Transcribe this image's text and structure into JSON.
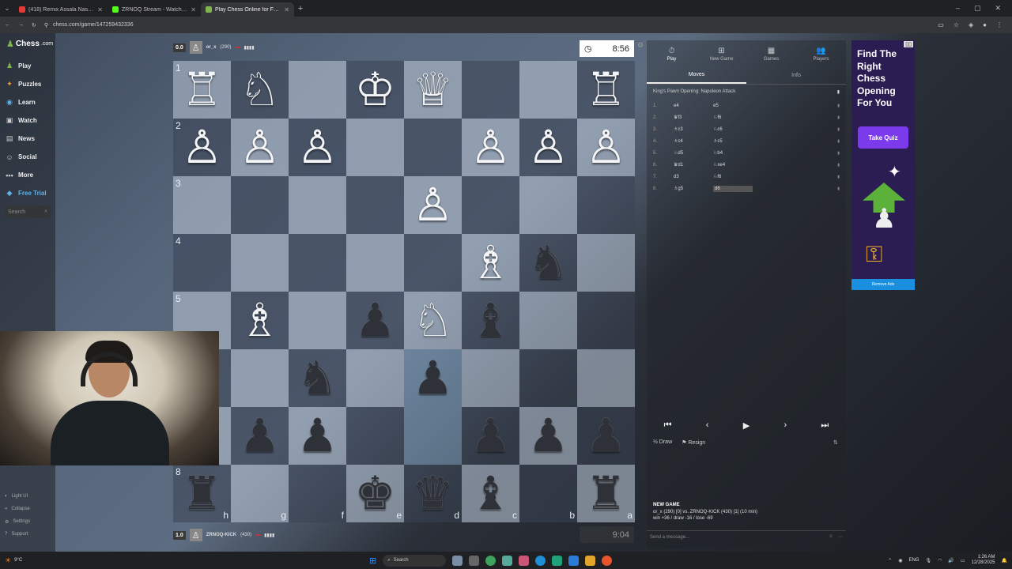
{
  "browser": {
    "tabs": [
      {
        "title": "(418) Remix Assala Nasri &",
        "color": "#e53935",
        "active": false
      },
      {
        "title": "ZRNOQ Stream - Watch Live o",
        "color": "#53fc18",
        "active": false
      },
      {
        "title": "Play Chess Online for FREE - 2",
        "color": "#81b64c",
        "active": true
      }
    ],
    "url": "chess.com/game/147259432336"
  },
  "sidebar": {
    "logo": "Chess",
    "logo_suffix": ".com",
    "items": [
      {
        "label": "Play",
        "icon": "♟",
        "color": "#81b64c"
      },
      {
        "label": "Puzzles",
        "icon": "✦",
        "color": "#f39c3d"
      },
      {
        "label": "Learn",
        "icon": "◉",
        "color": "#5fb2e8"
      },
      {
        "label": "Watch",
        "icon": "▣",
        "color": "#cccccc"
      },
      {
        "label": "News",
        "icon": "▤",
        "color": "#cccccc"
      },
      {
        "label": "Social",
        "icon": "☺",
        "color": "#cccccc"
      },
      {
        "label": "More",
        "icon": "•••",
        "color": "#cccccc"
      },
      {
        "label": "Free Trial",
        "icon": "◆",
        "color": "#5fb2e8"
      }
    ],
    "search_placeholder": "Search",
    "bottom": [
      {
        "label": "Light UI",
        "icon": "◐"
      },
      {
        "label": "Collapse",
        "icon": "«"
      },
      {
        "label": "Settings",
        "icon": "⚙"
      },
      {
        "label": "Support",
        "icon": "?"
      }
    ]
  },
  "top_player": {
    "score": "0.0",
    "name": "or_x",
    "rating": "(290)",
    "clock": "8:56"
  },
  "bottom_player": {
    "score": "1.0",
    "name": "ZRNOQ-KICK",
    "rating": "(430)",
    "clock": "9:04"
  },
  "board": {
    "ranks": [
      "1",
      "2",
      "3",
      "4",
      "5",
      "6",
      "7",
      "8"
    ],
    "files": [
      "h",
      "g",
      "f",
      "e",
      "d",
      "c",
      "b",
      "a"
    ],
    "highlight": [
      [
        5,
        4
      ],
      [
        6,
        4
      ]
    ],
    "pieces": [
      [
        {
          "c": 0,
          "t": "R",
          "s": "w"
        },
        {
          "c": 1,
          "t": "N",
          "s": "w"
        },
        {
          "c": 3,
          "t": "K",
          "s": "w"
        },
        {
          "c": 4,
          "t": "Q",
          "s": "w"
        },
        {
          "c": 7,
          "t": "R",
          "s": "w"
        }
      ],
      [
        {
          "c": 0,
          "t": "P",
          "s": "w"
        },
        {
          "c": 1,
          "t": "P",
          "s": "w"
        },
        {
          "c": 2,
          "t": "P",
          "s": "w"
        },
        {
          "c": 5,
          "t": "P",
          "s": "w"
        },
        {
          "c": 6,
          "t": "P",
          "s": "w"
        },
        {
          "c": 7,
          "t": "P",
          "s": "w"
        }
      ],
      [
        {
          "c": 4,
          "t": "P",
          "s": "w"
        }
      ],
      [
        {
          "c": 5,
          "t": "B",
          "s": "w"
        },
        {
          "c": 6,
          "t": "N",
          "s": "b"
        }
      ],
      [
        {
          "c": 1,
          "t": "B",
          "s": "w"
        },
        {
          "c": 3,
          "t": "P",
          "s": "b"
        },
        {
          "c": 4,
          "t": "N",
          "s": "w"
        },
        {
          "c": 5,
          "t": "B",
          "s": "b"
        }
      ],
      [
        {
          "c": 2,
          "t": "N",
          "s": "b"
        },
        {
          "c": 4,
          "t": "P",
          "s": "b"
        }
      ],
      [
        {
          "c": 1,
          "t": "P",
          "s": "b"
        },
        {
          "c": 2,
          "t": "P",
          "s": "b"
        },
        {
          "c": 5,
          "t": "P",
          "s": "b"
        },
        {
          "c": 6,
          "t": "P",
          "s": "b"
        },
        {
          "c": 7,
          "t": "P",
          "s": "b"
        }
      ],
      [
        {
          "c": 0,
          "t": "R",
          "s": "b"
        },
        {
          "c": 3,
          "t": "K",
          "s": "b"
        },
        {
          "c": 4,
          "t": "Q",
          "s": "b"
        },
        {
          "c": 5,
          "t": "B",
          "s": "b"
        },
        {
          "c": 7,
          "t": "R",
          "s": "b"
        }
      ]
    ]
  },
  "right_panel": {
    "tabs": [
      {
        "label": "Play",
        "icon": "⏱"
      },
      {
        "label": "New Game",
        "icon": "⊞"
      },
      {
        "label": "Games",
        "icon": "▦"
      },
      {
        "label": "Players",
        "icon": "👥"
      }
    ],
    "subtabs": [
      "Moves",
      "Info"
    ],
    "opening": "King's Pawn Opening: Napoleon Attack",
    "moves": [
      {
        "n": "1.",
        "w": "e4",
        "b": "e5"
      },
      {
        "n": "2.",
        "w": "♛f3",
        "b": "♘f6"
      },
      {
        "n": "3.",
        "w": "♗c3",
        "b": "♘c6"
      },
      {
        "n": "4.",
        "w": "♗c4",
        "b": "♗c5"
      },
      {
        "n": "5.",
        "w": "♘d5",
        "b": "♘b4"
      },
      {
        "n": "6.",
        "w": "♛d1",
        "b": "♘xe4"
      },
      {
        "n": "7.",
        "w": "d3",
        "b": "♘f6"
      },
      {
        "n": "8.",
        "w": "♗g5",
        "b": "d6"
      }
    ],
    "draw": "Draw",
    "resign": "Resign",
    "new_game_title": "NEW GAME",
    "new_game_line1": "or_x (290) [0] vs. ZRNOQ-KICK (430) [1] (10 min)",
    "new_game_line2": "win +36 / draw -16 / lose -69",
    "message_placeholder": "Send a message..."
  },
  "ad": {
    "title": "Find The Right Chess Opening For You",
    "button": "Take Quiz",
    "remove": "Remove Ads"
  },
  "taskbar": {
    "temp": "9°C",
    "search": "Search",
    "lang": "ENG",
    "time": "1:26 AM",
    "date": "12/28/2025"
  }
}
